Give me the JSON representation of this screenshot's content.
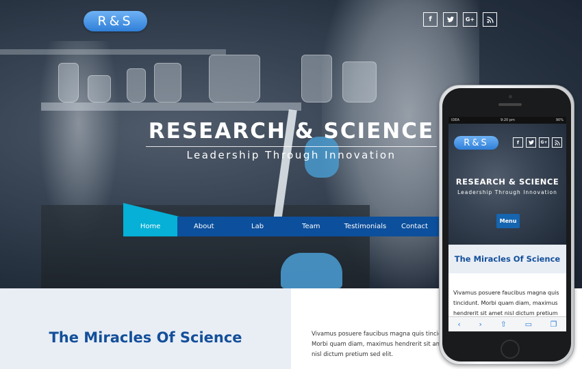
{
  "brand": {
    "logo_text": "R&S"
  },
  "social": {
    "facebook": "f",
    "twitter": "t",
    "googleplus": "G+",
    "rss": "rss"
  },
  "hero": {
    "title": "RESEARCH & SCIENCE",
    "subtitle": "Leadership Through Innovation"
  },
  "nav": {
    "items": [
      "Home",
      "About",
      "Lab",
      "Team",
      "Testimonials",
      "Contact"
    ],
    "active_index": 0
  },
  "section": {
    "heading": "The Miracles Of Science",
    "body": "Vivamus posuere faucibus magna quis tincidunt. Morbi quam diam, maximus hendrerit sit amet nisl dictum pretium sed elit."
  },
  "phone": {
    "status": {
      "carrier": "IDEA",
      "time": "9:20 pm",
      "battery": "90%"
    },
    "logo_text": "R&S",
    "title": "RESEARCH & SCIENCE",
    "subtitle": "Leadership Through Innovation",
    "menu_label": "Menu",
    "section_heading": "The Miracles Of Science",
    "section_body": "Vivamus posuere faucibus magna quis tincidunt. Morbi quam diam, maximus hendrerit sit amet nisl dictum pretium",
    "toolbar": [
      "‹",
      "›",
      "⇧",
      "▭",
      "❐"
    ]
  },
  "colors": {
    "nav_bg": "#0c4f9c",
    "nav_active": "#06b0d6",
    "heading": "#134f9a",
    "logo": "#2f7fd8"
  }
}
